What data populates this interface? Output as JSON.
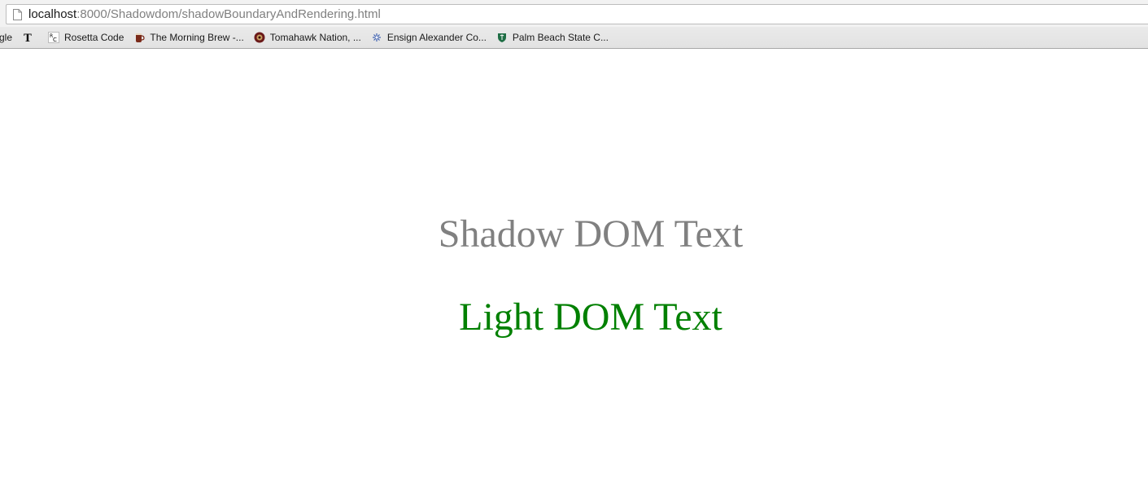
{
  "browser": {
    "url_host": "localhost",
    "url_rest": ":8000/Shadowdom/shadowBoundaryAndRendering.html"
  },
  "bookmarks": [
    {
      "label": "gle",
      "icon": "google-icon"
    },
    {
      "label": "",
      "icon": "nytimes-icon"
    },
    {
      "label": "Rosetta Code",
      "icon": "rosetta-code-icon"
    },
    {
      "label": "The Morning Brew -...",
      "icon": "morning-brew-icon"
    },
    {
      "label": "Tomahawk Nation, ...",
      "icon": "tomahawk-nation-icon"
    },
    {
      "label": "Ensign Alexander Co...",
      "icon": "ensign-icon"
    },
    {
      "label": "Palm Beach State C...",
      "icon": "palm-beach-state-icon"
    }
  ],
  "page": {
    "shadow_text": "Shadow DOM Text",
    "light_text": "Light DOM Text"
  },
  "colors": {
    "shadow_text": "#808080",
    "light_text": "#008000"
  }
}
